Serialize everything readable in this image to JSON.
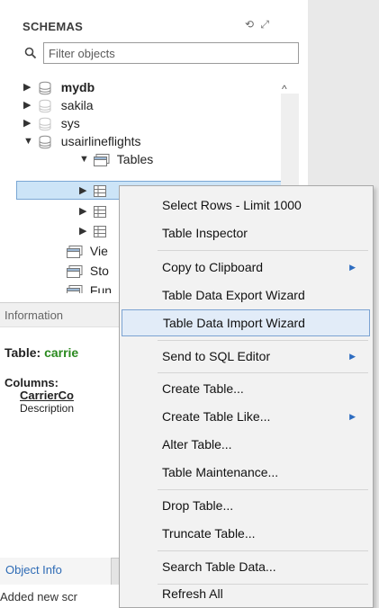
{
  "schemas": {
    "title": "SCHEMAS",
    "filter_placeholder": "Filter objects",
    "tree": {
      "db_mydb": "mydb",
      "db_sakila": "sakila",
      "db_sys": "sys",
      "db_usairlineflights": "usairlineflights",
      "tables_label": "Tables",
      "views_partial": "Vie",
      "stored_partial": "Sto",
      "functions_partial": "Fun"
    }
  },
  "information": {
    "header": "Information",
    "table_prefix": "Table: ",
    "table_name": "carrie",
    "columns_label": "Columns:",
    "column_name": "CarrierCo",
    "column_description": "Description"
  },
  "bottom": {
    "tab_object_info": "Object Info",
    "status": "Added new scr"
  },
  "context_menu": {
    "items": [
      {
        "label": "Select Rows - Limit 1000",
        "submenu": false
      },
      {
        "label": "Table Inspector",
        "submenu": false
      },
      {
        "label": "Copy to Clipboard",
        "submenu": true
      },
      {
        "label": "Table Data Export Wizard",
        "submenu": false
      },
      {
        "label": "Table Data Import Wizard",
        "submenu": false,
        "highlighted": true
      },
      {
        "label": "Send to SQL Editor",
        "submenu": true
      },
      {
        "label": "Create Table...",
        "submenu": false
      },
      {
        "label": "Create Table Like...",
        "submenu": true
      },
      {
        "label": "Alter Table...",
        "submenu": false
      },
      {
        "label": "Table Maintenance...",
        "submenu": false
      },
      {
        "label": "Drop Table...",
        "submenu": false
      },
      {
        "label": "Truncate Table...",
        "submenu": false
      },
      {
        "label": "Search Table Data...",
        "submenu": false
      },
      {
        "label": "Refresh All",
        "submenu": false
      }
    ],
    "submenu_arrow": "▶"
  },
  "colors": {
    "selection": "#cce4f7",
    "table_name_green": "#2b8a1f",
    "menu_highlight": "#e2ecf8",
    "arrow_blue": "#2d6cc0"
  }
}
